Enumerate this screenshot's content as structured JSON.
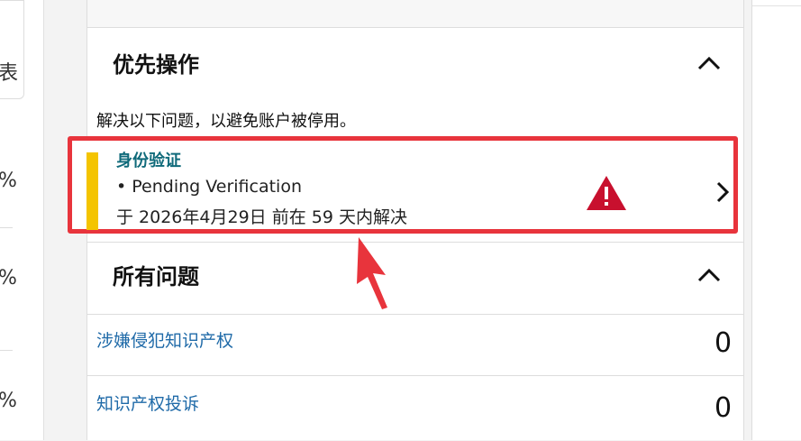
{
  "left_glyphs": [
    "表",
    "%",
    "%",
    "%"
  ],
  "priority": {
    "title": "优先操作",
    "subtitle": "解决以下问题，以避免账户被停用。",
    "task": {
      "title": "身份验证",
      "item": "• Pending Verification",
      "deadline": "于 2026年4月29日 前在 59 天内解决",
      "bar_color": "#f4c400",
      "title_color": "#0f6a7a",
      "highlight_color": "#e8343c",
      "warning_icon": "warning-triangle-icon"
    }
  },
  "all_issues": {
    "title": "所有问题",
    "items": [
      {
        "label": "涉嫌侵犯知识产权",
        "count": "0"
      },
      {
        "label": "知识产权投诉",
        "count": "0"
      }
    ]
  }
}
